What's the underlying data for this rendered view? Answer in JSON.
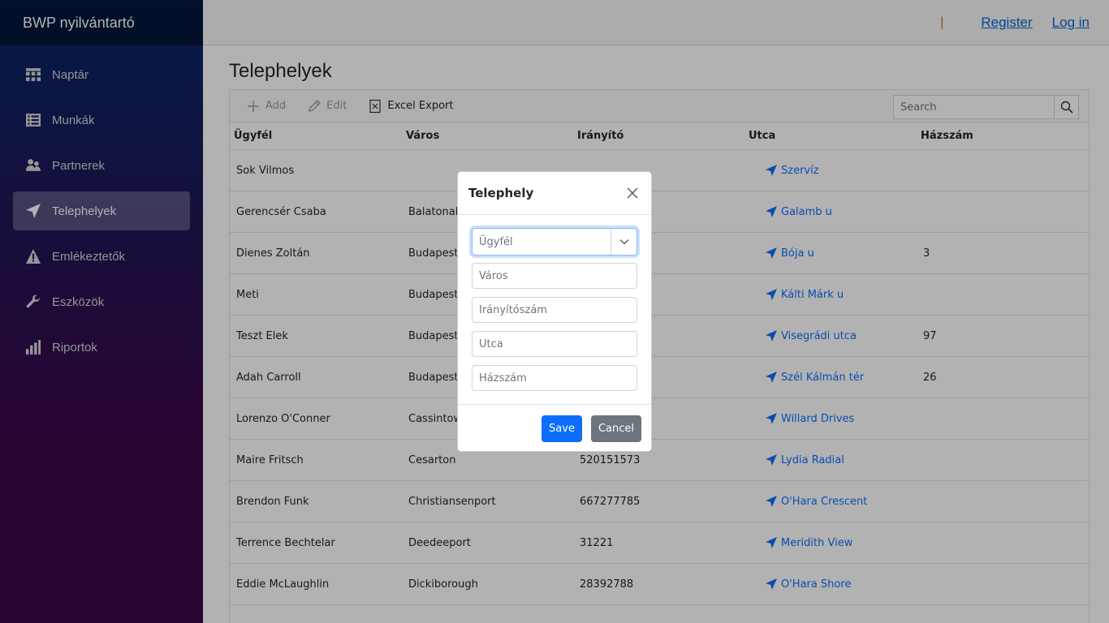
{
  "app": {
    "brand": "BWP nyilvántartó"
  },
  "sidebar": {
    "items": [
      {
        "label": "Naptár",
        "icon": "calendar-icon"
      },
      {
        "label": "Munkák",
        "icon": "list-icon"
      },
      {
        "label": "Partnerek",
        "icon": "people-icon"
      },
      {
        "label": "Telephelyek",
        "icon": "location-arrow-icon",
        "active": true
      },
      {
        "label": "Emlékeztetők",
        "icon": "warning-icon"
      },
      {
        "label": "Eszközök",
        "icon": "wrench-icon"
      },
      {
        "label": "Riportok",
        "icon": "bar-chart-icon"
      }
    ]
  },
  "header": {
    "separator": "|",
    "register": "Register",
    "login": "Log in"
  },
  "page": {
    "title": "Telephelyek"
  },
  "toolbar": {
    "add": "Add",
    "edit": "Edit",
    "export": "Excel Export",
    "search_placeholder": "Search"
  },
  "table": {
    "columns": [
      "Ügyfél",
      "Város",
      "Irányító",
      "Utca",
      "Házszám"
    ],
    "rows": [
      [
        "Sok Vilmos",
        "",
        "",
        "Szervíz",
        ""
      ],
      [
        "Gerencsér Csaba",
        "Balatonak",
        "",
        "Galamb u",
        ""
      ],
      [
        "Dienes Zoltán",
        "Budapest",
        "",
        "Bója u",
        "3"
      ],
      [
        "Meti",
        "Budapest",
        "",
        "Kálti Márk u",
        ""
      ],
      [
        "Teszt Elek",
        "Budapest",
        "",
        "Visegrádi utca",
        "97"
      ],
      [
        "Adah Carroll",
        "Budapest",
        "",
        "Szél Kálmán tér",
        "26"
      ],
      [
        "Lorenzo O'Conner",
        "Cassintow",
        "",
        "Willard Drives",
        ""
      ],
      [
        "Maire Fritsch",
        "Cesarton",
        "520151573",
        "Lydia Radial",
        ""
      ],
      [
        "Brendon Funk",
        "Christiansenport",
        "667277785",
        "O'Hara Crescent",
        ""
      ],
      [
        "Terrence Bechtelar",
        "Deedeeport",
        "31221",
        "Meridith View",
        ""
      ],
      [
        "Eddie McLaughlin",
        "Dickiborough",
        "28392788",
        "O'Hara Shore",
        ""
      ]
    ]
  },
  "modal": {
    "title": "Telephely",
    "select_placeholder": "Ügyfél",
    "fields": [
      "Város",
      "Irányítószám",
      "Utca",
      "Házszám"
    ],
    "save": "Save",
    "cancel": "Cancel"
  }
}
